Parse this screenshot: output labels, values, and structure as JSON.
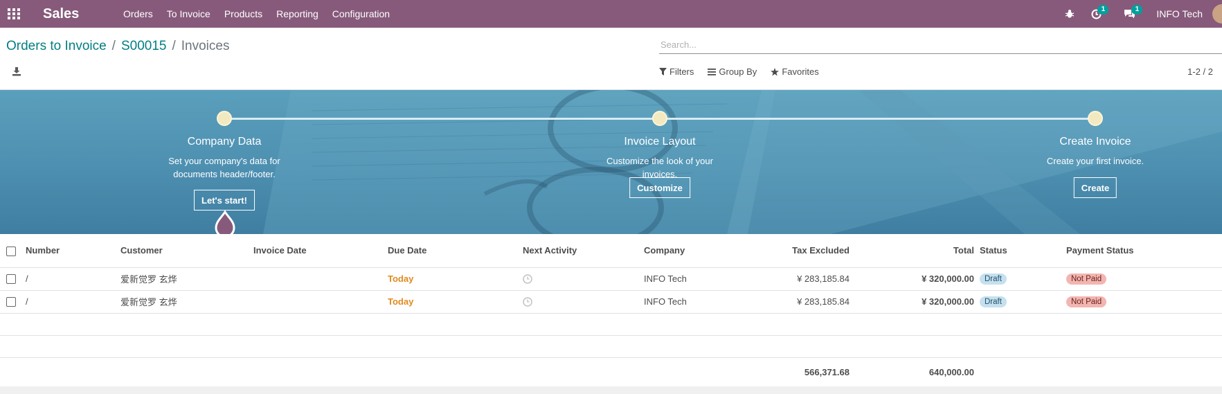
{
  "navbar": {
    "app_name": "Sales",
    "menu": [
      "Orders",
      "To Invoice",
      "Products",
      "Reporting",
      "Configuration"
    ],
    "activity_count": "1",
    "message_count": "1",
    "company": "INFO Tech"
  },
  "breadcrumb": {
    "root": "Orders to Invoice",
    "middle": "S00015",
    "current": "Invoices",
    "separator": "/"
  },
  "search": {
    "placeholder": "Search..."
  },
  "filters": {
    "filters": "Filters",
    "group_by": "Group By",
    "favorites": "Favorites"
  },
  "pager": "1-2 / 2",
  "onboarding": {
    "steps": [
      {
        "title": "Company Data",
        "desc": "Set your company's data for documents header/footer.",
        "button": "Let's start!"
      },
      {
        "title": "Invoice Layout",
        "desc": "Customize the look of your invoices.",
        "button": "Customize"
      },
      {
        "title": "Create Invoice",
        "desc": "Create your first invoice.",
        "button": "Create"
      }
    ]
  },
  "table": {
    "headers": [
      "Number",
      "Customer",
      "Invoice Date",
      "Due Date",
      "Next Activity",
      "Company",
      "Tax Excluded",
      "Total",
      "Status",
      "Payment Status"
    ],
    "rows": [
      {
        "number": "/",
        "customer": "爱新觉罗 玄烨",
        "invoice_date": "",
        "due_date": "Today",
        "company": "INFO Tech",
        "tax_excluded": "¥ 283,185.84",
        "total": "¥ 320,000.00",
        "status": "Draft",
        "payment_status": "Not Paid"
      },
      {
        "number": "/",
        "customer": "爱新觉罗 玄烨",
        "invoice_date": "",
        "due_date": "Today",
        "company": "INFO Tech",
        "tax_excluded": "¥ 283,185.84",
        "total": "¥ 320,000.00",
        "status": "Draft",
        "payment_status": "Not Paid"
      }
    ],
    "totals": {
      "tax_excluded": "566,371.68",
      "total": "640,000.00"
    }
  },
  "colors": {
    "brand": "#875a7b",
    "link": "#017e84",
    "due_today": "#e08a20",
    "badge": "#00a09d"
  }
}
